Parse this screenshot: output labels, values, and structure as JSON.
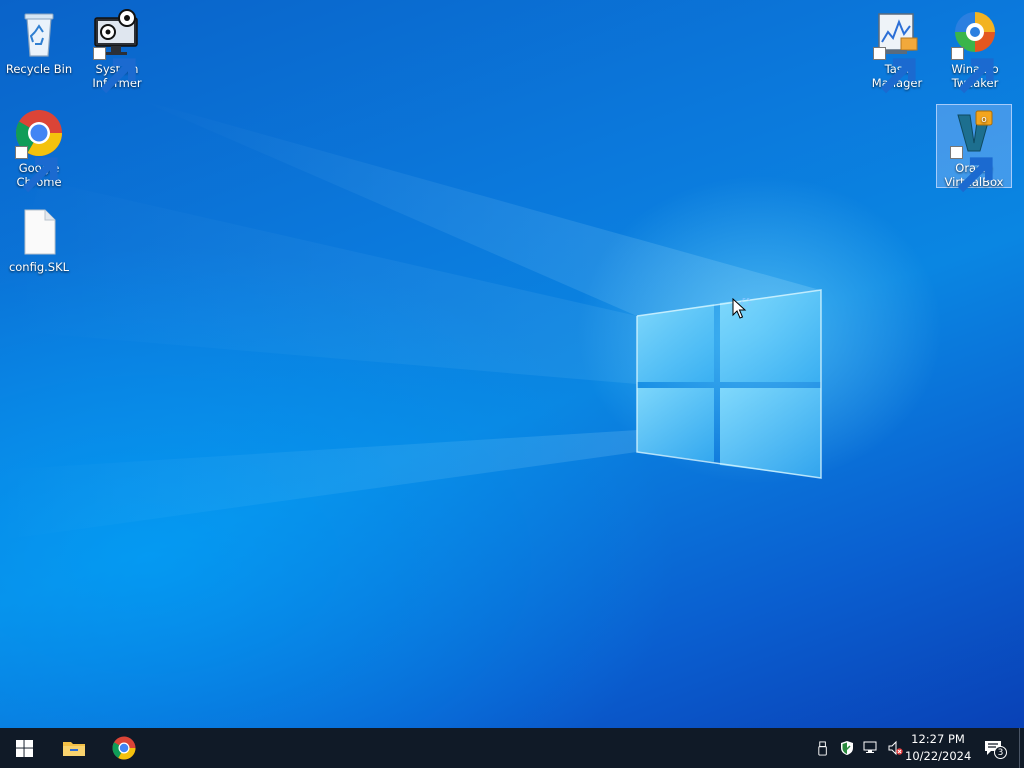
{
  "desktop": {
    "icons": [
      {
        "label": "Recycle Bin",
        "icon": "recycle-bin-icon"
      },
      {
        "label": "System Informer",
        "icon": "system-informer-icon"
      },
      {
        "label": "Google Chrome",
        "icon": "chrome-icon"
      },
      {
        "label": "config.SKL",
        "icon": "file-icon"
      },
      {
        "label": "Task Manager",
        "icon": "task-manager-icon"
      },
      {
        "label": "Winaero Tweaker",
        "icon": "winaero-tweaker-icon"
      },
      {
        "label": "Oracle VirtualBox",
        "icon": "virtualbox-icon",
        "selected": true
      }
    ],
    "wallpaper": "windows-10-hero-wallpaper"
  },
  "taskbar": {
    "start_icon": "windows-start-icon",
    "pinned": [
      {
        "name": "File Explorer",
        "icon": "file-explorer-icon"
      },
      {
        "name": "Google Chrome",
        "icon": "chrome-icon"
      }
    ],
    "tray": [
      {
        "icon": "usb-device-icon"
      },
      {
        "icon": "windows-security-icon"
      },
      {
        "icon": "network-icon"
      },
      {
        "icon": "volume-muted-icon"
      }
    ],
    "clock": {
      "time": "12:27 PM",
      "date": "10/22/2024"
    },
    "notifications": {
      "icon": "action-center-icon",
      "count": "3"
    }
  },
  "colors": {
    "taskbar_bg": "#101a27",
    "wallpaper_blue": "#0a7ad8",
    "selection": "#aac8ff"
  }
}
